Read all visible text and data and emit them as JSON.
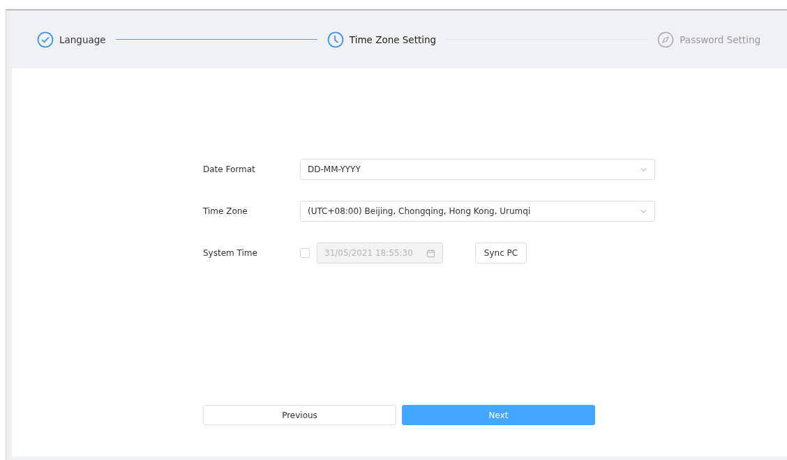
{
  "steps": [
    {
      "label": "Language",
      "kind": "done"
    },
    {
      "label": "Time Zone Setting",
      "kind": "current"
    },
    {
      "label": "Password Setting",
      "kind": "pending"
    }
  ],
  "form": {
    "rows": [
      {
        "kind": "select",
        "label": "Date Format",
        "value": "DD-MM-YYYY"
      },
      {
        "kind": "select",
        "label": "Time Zone",
        "value": "(UTC+08:00) Beijing, Chongqing, Hong Kong, Urumqi"
      },
      {
        "kind": "datetime",
        "label": "System Time",
        "checked": false,
        "disabled": true,
        "value": "31/05/2021 18:55:30",
        "button": "Sync PC"
      }
    ]
  },
  "buttons": [
    {
      "label": "Previous",
      "kind": "secondary"
    },
    {
      "label": "Next",
      "kind": "primary"
    }
  ]
}
